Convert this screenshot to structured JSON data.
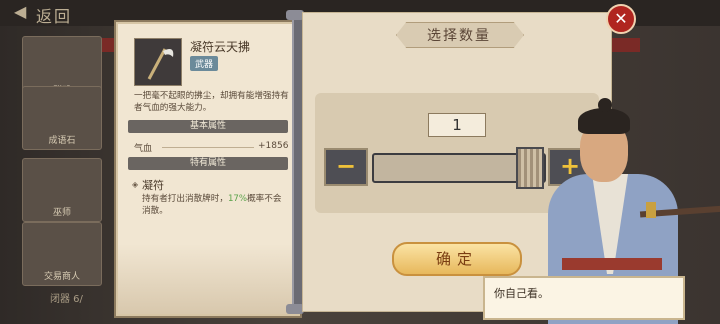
{
  "background": {
    "back_label": "返回",
    "side_items": [
      "群殴",
      "成语石",
      "巫师",
      "交易商人"
    ],
    "footer_text": "闭器 6/"
  },
  "item": {
    "name": "凝符云天拂",
    "type_badge": "武器",
    "description": "一把毫不起眼的拂尘，却拥有能增强持有者气血的强大能力。",
    "basic_header": "基本属性",
    "attr_label": "气血",
    "attr_value": "+1856",
    "special_header": "特有属性",
    "special_name": "凝符",
    "special_desc_before": "持有者打出消散牌时，",
    "special_highlight": "17%",
    "special_desc_after": "概率不会消散。"
  },
  "quantity_panel": {
    "title": "选择数量",
    "quantity": "1",
    "slider_value": 1,
    "minus_symbol": "−",
    "plus_symbol": "+",
    "confirm_label": "确定",
    "close_symbol": "✕"
  },
  "dialogue": {
    "text": "你自己看。"
  },
  "colors": {
    "accent_gold": "#f0c23a",
    "close_red": "#b0251f",
    "highlight_green": "#5aa24a"
  }
}
